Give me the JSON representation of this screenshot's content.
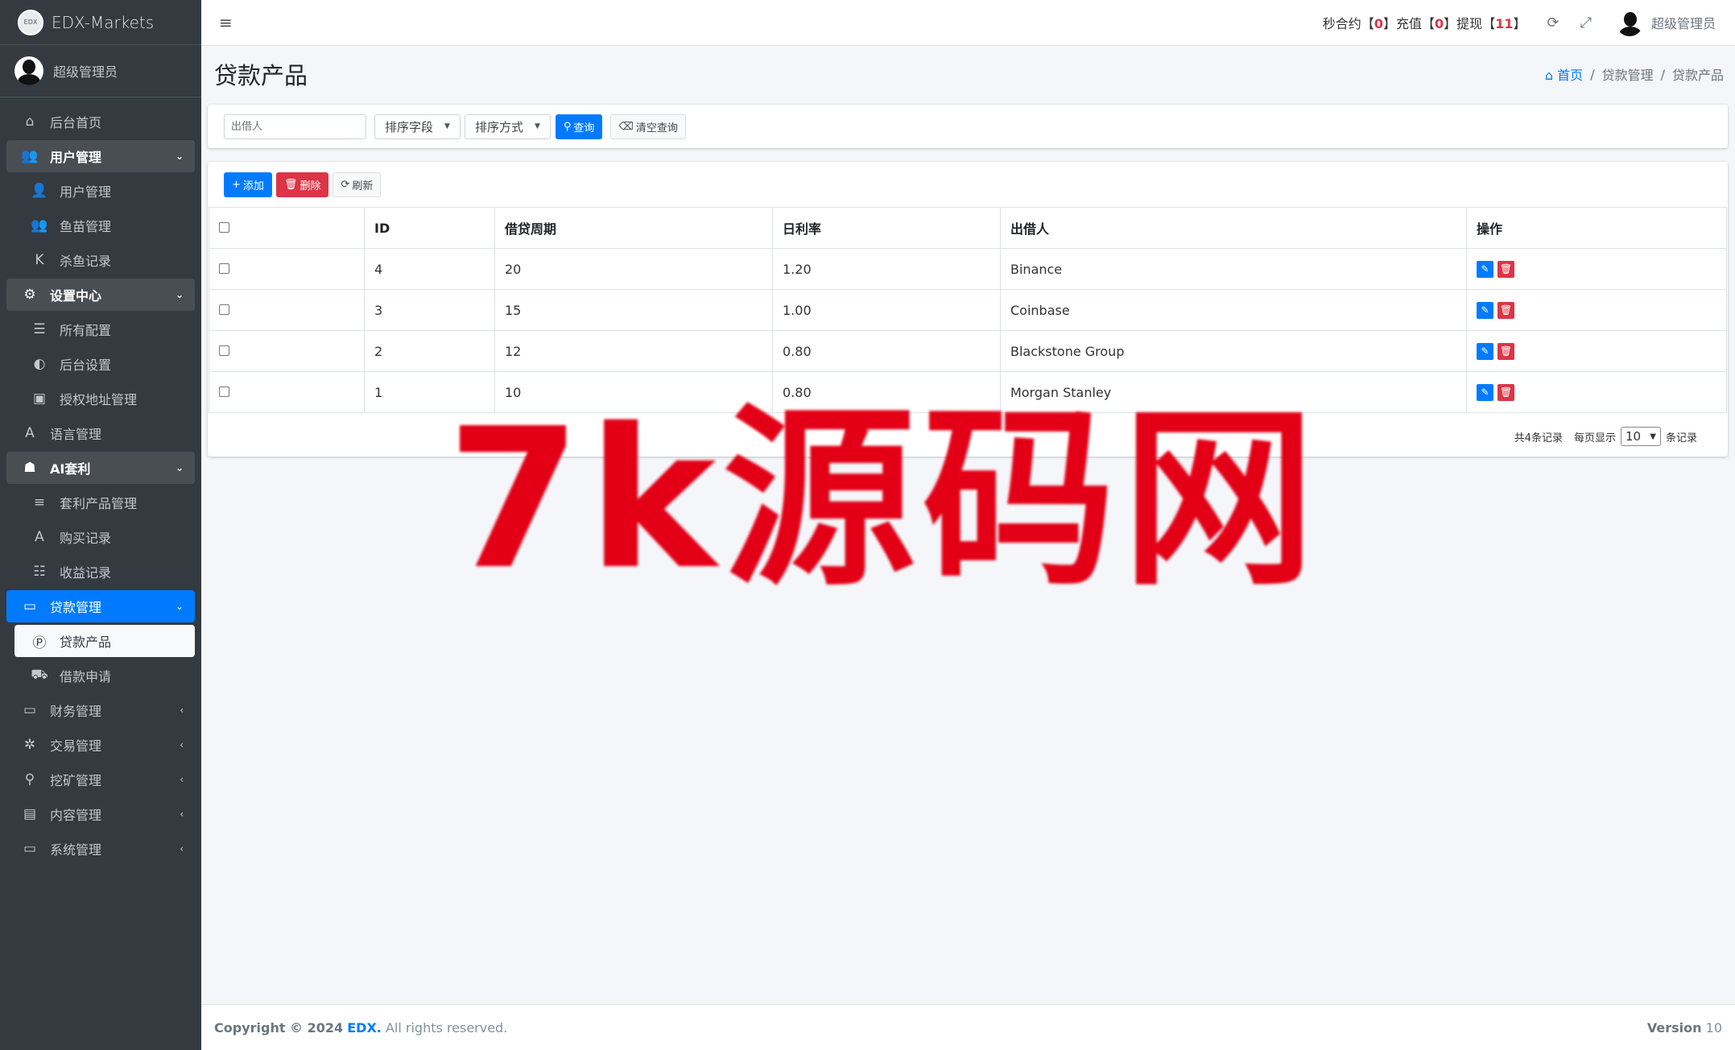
{
  "brand": {
    "logo_text": "EDX",
    "name": "EDX-Markets"
  },
  "sidebar": {
    "user": "超级管理员",
    "items": [
      {
        "label": "后台首页",
        "icon": "home-icon",
        "glyph": "⌂",
        "type": "item"
      },
      {
        "label": "用户管理",
        "icon": "users-icon",
        "glyph": "👥",
        "type": "open",
        "arrow": "⌄"
      },
      {
        "label": "用户管理",
        "icon": "user-icon",
        "glyph": "👤",
        "type": "sub"
      },
      {
        "label": "鱼苗管理",
        "icon": "users-icon",
        "glyph": "👥",
        "type": "sub"
      },
      {
        "label": "杀鱼记录",
        "icon": "k-icon",
        "glyph": "K",
        "type": "sub"
      },
      {
        "label": "设置中心",
        "icon": "gears-icon",
        "glyph": "⚙",
        "type": "open",
        "arrow": "⌄"
      },
      {
        "label": "所有配置",
        "icon": "list-icon",
        "glyph": "☰",
        "type": "sub"
      },
      {
        "label": "后台设置",
        "icon": "adjust-icon",
        "glyph": "◐",
        "type": "sub"
      },
      {
        "label": "授权地址管理",
        "icon": "address-book-icon",
        "glyph": "▣",
        "type": "sub"
      },
      {
        "label": "语言管理",
        "icon": "language-icon",
        "glyph": "A",
        "type": "item"
      },
      {
        "label": "AI套利",
        "icon": "android-icon",
        "glyph": "☗",
        "type": "open",
        "arrow": "⌄"
      },
      {
        "label": "套利产品管理",
        "icon": "bars-icon",
        "glyph": "≡",
        "type": "sub"
      },
      {
        "label": "购买记录",
        "icon": "font-icon",
        "glyph": "A",
        "type": "sub"
      },
      {
        "label": "收益记录",
        "icon": "tasks-icon",
        "glyph": "☷",
        "type": "sub"
      },
      {
        "label": "贷款管理",
        "icon": "money-icon",
        "glyph": "▭",
        "type": "active",
        "arrow": "⌄"
      },
      {
        "label": "贷款产品",
        "icon": "product-hunt-icon",
        "glyph": "Ⓟ",
        "type": "sub-active"
      },
      {
        "label": "借款申请",
        "icon": "truck-icon",
        "glyph": "⛟",
        "type": "sub"
      },
      {
        "label": "财务管理",
        "icon": "money-icon",
        "glyph": "▭",
        "type": "item",
        "arrow": "‹"
      },
      {
        "label": "交易管理",
        "icon": "connectdevelop-icon",
        "glyph": "✲",
        "type": "item",
        "arrow": "‹"
      },
      {
        "label": "挖矿管理",
        "icon": "search-icon",
        "glyph": "⚲",
        "type": "item",
        "arrow": "‹"
      },
      {
        "label": "内容管理",
        "icon": "newspaper-icon",
        "glyph": "▤",
        "type": "item",
        "arrow": "‹"
      },
      {
        "label": "系统管理",
        "icon": "desktop-icon",
        "glyph": "▭",
        "type": "item",
        "arrow": "‹"
      }
    ]
  },
  "topbar": {
    "menu_glyph": "≡",
    "seconds_label": "秒合约",
    "seconds_count": "0",
    "recharge_label": "充值",
    "recharge_count": "0",
    "withdraw_label": "提现",
    "withdraw_count": "11",
    "bracket_open": "【",
    "bracket_close": "】",
    "refresh_glyph": "⟳",
    "fullscreen_glyph": "⤢",
    "user": "超级管理员"
  },
  "page": {
    "title": "贷款产品",
    "breadcrumb": {
      "home_glyph": "⌂",
      "home": "首页",
      "parent": "贷款管理",
      "current": "贷款产品",
      "sep": "/"
    }
  },
  "search": {
    "lender_placeholder": "出借人",
    "sort_field": "排序字段",
    "sort_order": "排序方式",
    "query_label": "查询",
    "query_glyph": "⚲",
    "clear_label": "清空查询",
    "clear_glyph": "⌫"
  },
  "toolbar": {
    "add_label": "添加",
    "add_glyph": "+",
    "delete_label": "删除",
    "delete_glyph": "🗑",
    "refresh_label": "刷新",
    "refresh_glyph": "⟳"
  },
  "table": {
    "headers": {
      "id": "ID",
      "period": "借贷周期",
      "rate": "日利率",
      "lender": "出借人",
      "ops": "操作"
    },
    "rows": [
      {
        "id": "4",
        "period": "20",
        "rate": "1.20",
        "lender": "Binance"
      },
      {
        "id": "3",
        "period": "15",
        "rate": "1.00",
        "lender": "Coinbase"
      },
      {
        "id": "2",
        "period": "12",
        "rate": "0.80",
        "lender": "Blackstone Group"
      },
      {
        "id": "1",
        "period": "10",
        "rate": "0.80",
        "lender": "Morgan Stanley"
      }
    ],
    "edit_glyph": "✎",
    "delete_glyph": "🗑"
  },
  "pager": {
    "total": "共4条记录",
    "per_page_label": "每页显示",
    "per_page": "10",
    "suffix": "条记录"
  },
  "watermark": "7k源码网",
  "footer": {
    "copyright": "Copyright © 2024",
    "brand": "EDX.",
    "rights": "All rights reserved.",
    "version_label": "Version",
    "version": "10"
  }
}
